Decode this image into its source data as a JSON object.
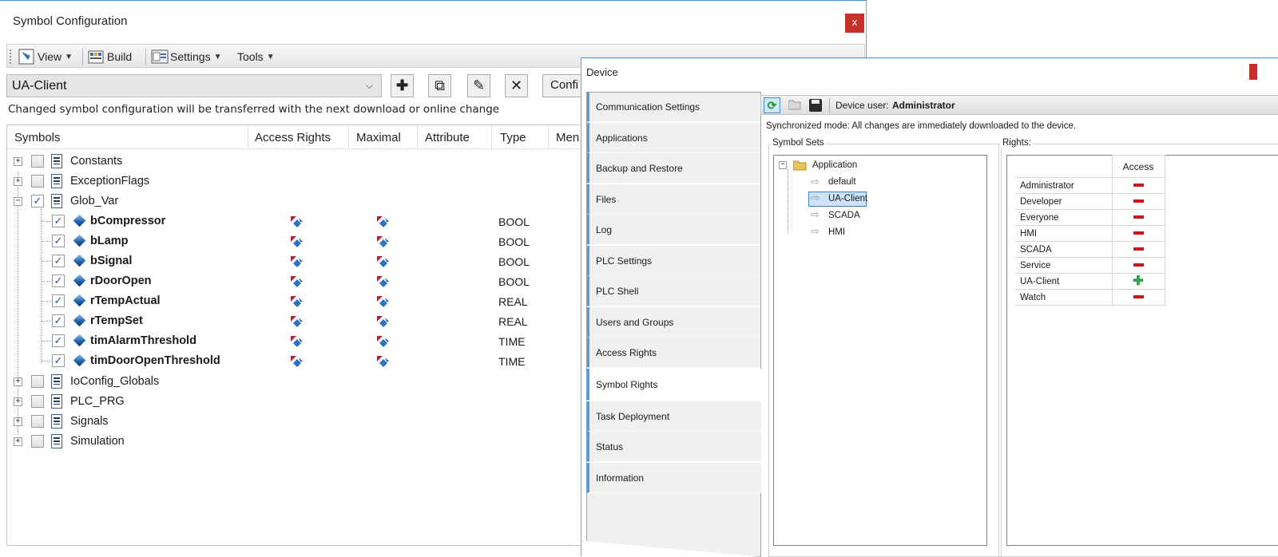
{
  "symcfg": {
    "title": "Symbol Configuration",
    "close": "x",
    "toolbar": {
      "view": "View",
      "build": "Build",
      "settings": "Settings",
      "tools": "Tools"
    },
    "combo_value": "UA-Client",
    "config_button": "Confi",
    "info": "Changed symbol configuration will be transferred with the next download or online change",
    "columns": [
      "Symbols",
      "Access Rights",
      "Maximal",
      "Attribute",
      "Type",
      "Men"
    ],
    "groups": {
      "constants": "Constants",
      "exception_flags": "ExceptionFlags",
      "glob_var": "Glob_Var",
      "ioconfig": "IoConfig_Globals",
      "plc_prg": "PLC_PRG",
      "signals": "Signals",
      "simulation": "Simulation"
    },
    "variables": [
      {
        "name": "bCompressor",
        "type": "BOOL"
      },
      {
        "name": "bLamp",
        "type": "BOOL"
      },
      {
        "name": "bSignal",
        "type": "BOOL"
      },
      {
        "name": "rDoorOpen",
        "type": "BOOL"
      },
      {
        "name": "rTempActual",
        "type": "REAL"
      },
      {
        "name": "rTempSet",
        "type": "REAL"
      },
      {
        "name": "timAlarmThreshold",
        "type": "TIME"
      },
      {
        "name": "timDoorOpenThreshold",
        "type": "TIME"
      }
    ]
  },
  "device": {
    "title": "Device",
    "tabs": [
      "Communication Settings",
      "Applications",
      "Backup and Restore",
      "Files",
      "Log",
      "PLC Settings",
      "PLC Shell",
      "Users and Groups",
      "Access Rights",
      "Symbol Rights",
      "Task Deployment",
      "Status",
      "Information"
    ],
    "active_tab": "Symbol Rights",
    "device_user_label": "Device user:",
    "device_user": "Administrator",
    "sync_mode": "Synchronized mode: All changes are immediately downloaded to the device.",
    "symbol_sets_label": "Symbol Sets",
    "rights_label": "Rights:",
    "tree": {
      "root": "Application",
      "sets": [
        "default",
        "UA-Client",
        "SCADA",
        "HMI"
      ],
      "selected": "UA-Client"
    },
    "access_header": "Access",
    "rights": [
      {
        "group": "Administrator",
        "access": "denied"
      },
      {
        "group": "Developer",
        "access": "denied"
      },
      {
        "group": "Everyone",
        "access": "denied"
      },
      {
        "group": "HMI",
        "access": "denied"
      },
      {
        "group": "SCADA",
        "access": "denied"
      },
      {
        "group": "Service",
        "access": "denied"
      },
      {
        "group": "UA-Client",
        "access": "granted"
      },
      {
        "group": "Watch",
        "access": "denied"
      }
    ]
  }
}
